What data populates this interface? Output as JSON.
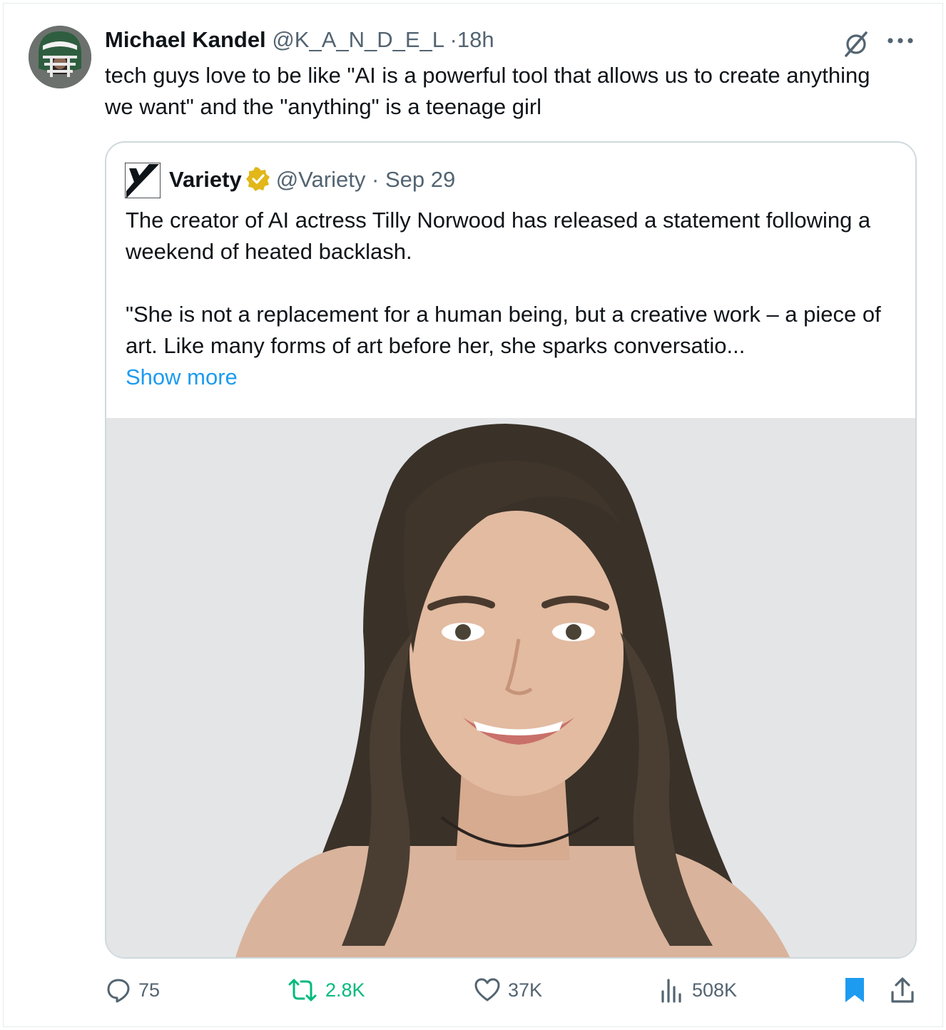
{
  "tweet": {
    "author_name": "Michael Kandel",
    "author_handle": "@K_A_N_D_E_L",
    "separator": "·",
    "time": "18h",
    "text": "tech guys love to be like \"AI is a powerful tool that allows us to create anything we want\" and the \"anything\" is a teenage girl",
    "icons": [
      "grok-icon",
      "more-icon"
    ]
  },
  "quote": {
    "logo_letter": "V",
    "name": "Variety",
    "handle": "@Variety",
    "separator": "·",
    "date": "Sep 29",
    "text_p1": "The creator of AI actress Tilly Norwood has released a statement following a weekend of heated backlash.",
    "text_p2": "\"She is not a replacement for a human being, but a creative work – a piece of art. Like many forms of art before her, she sparks conversatio...",
    "show_more": "Show more",
    "verified_color": "#e2b719",
    "link_color": "#1d9bf0"
  },
  "actions": {
    "replies": "75",
    "reposts": "2.8K",
    "likes": "37K",
    "views": "508K",
    "repost_color": "#00ba7c",
    "bookmark_color": "#1d9bf0",
    "icons": [
      "reply-icon",
      "repost-icon",
      "like-icon",
      "views-icon",
      "bookmark-icon",
      "share-icon"
    ]
  }
}
